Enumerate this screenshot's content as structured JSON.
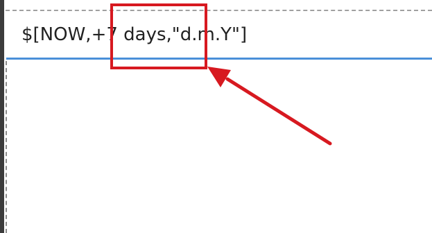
{
  "editor": {
    "expression_value": "$[NOW,+7 days,\"d.m.Y\"]"
  },
  "annotation": {
    "highlight_color": "#d71920",
    "target_text": "+7 days,"
  },
  "colors": {
    "input_focus_border": "#4a90d9",
    "left_bar": "#3c3c3c",
    "text": "#222222"
  }
}
